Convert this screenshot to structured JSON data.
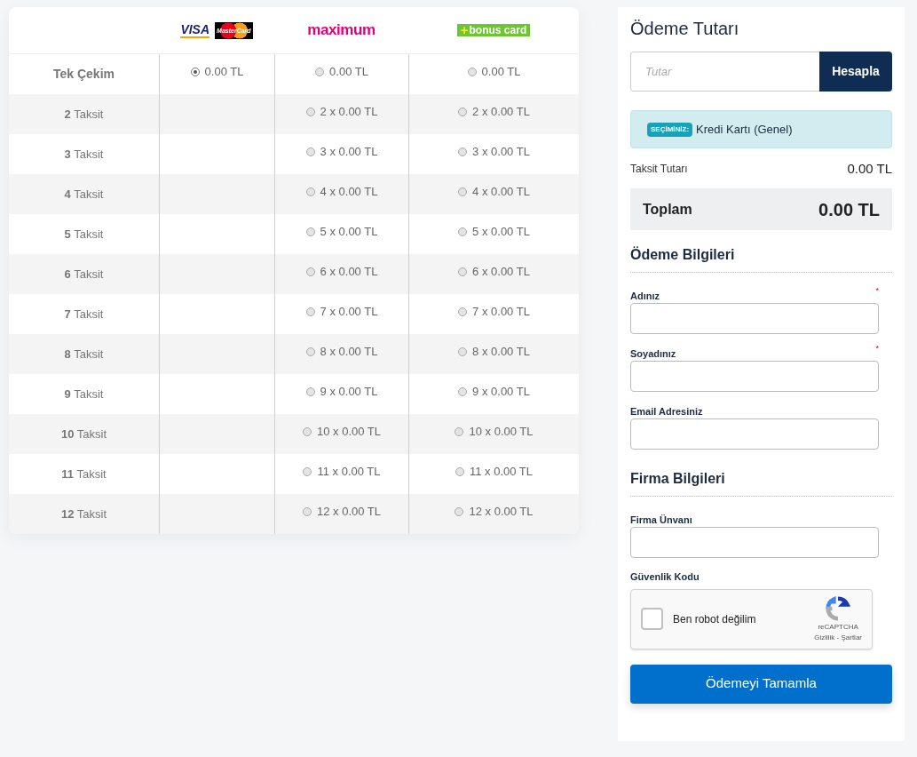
{
  "table": {
    "columns": [
      {
        "kind": "visa-mastercard",
        "logo_texts": [
          "VISA",
          "MasterCard"
        ]
      },
      {
        "kind": "maximum",
        "logo_texts": [
          "maximum"
        ]
      },
      {
        "kind": "bonus",
        "logo_texts": [
          "+",
          "bonus card"
        ]
      }
    ],
    "rows": [
      {
        "label": "Tek Çekim",
        "cells": [
          {
            "kind": "option",
            "text": "0.00 TL",
            "selected": true
          },
          {
            "kind": "option",
            "text": "0.00 TL",
            "selected": false
          },
          {
            "kind": "option",
            "text": "0.00 TL",
            "selected": false
          }
        ]
      },
      {
        "label": "**2** Taksit",
        "cells": [
          {
            "kind": "empty"
          },
          {
            "kind": "option",
            "text": "2 x 0.00 TL",
            "selected": false
          },
          {
            "kind": "option",
            "text": "2 x 0.00 TL",
            "selected": false
          }
        ]
      },
      {
        "label": "**3** Taksit",
        "cells": [
          {
            "kind": "empty"
          },
          {
            "kind": "option",
            "text": "3 x 0.00 TL",
            "selected": false
          },
          {
            "kind": "option",
            "text": "3 x 0.00 TL",
            "selected": false
          }
        ]
      },
      {
        "label": "**4** Taksit",
        "cells": [
          {
            "kind": "empty"
          },
          {
            "kind": "option",
            "text": "4 x 0.00 TL",
            "selected": false
          },
          {
            "kind": "option",
            "text": "4 x 0.00 TL",
            "selected": false
          }
        ]
      },
      {
        "label": "**5** Taksit",
        "cells": [
          {
            "kind": "empty"
          },
          {
            "kind": "option",
            "text": "5 x 0.00 TL",
            "selected": false
          },
          {
            "kind": "option",
            "text": "5 x 0.00 TL",
            "selected": false
          }
        ]
      },
      {
        "label": "**6** Taksit",
        "cells": [
          {
            "kind": "empty"
          },
          {
            "kind": "option",
            "text": "6 x 0.00 TL",
            "selected": false
          },
          {
            "kind": "option",
            "text": "6 x 0.00 TL",
            "selected": false
          }
        ]
      },
      {
        "label": "**7** Taksit",
        "cells": [
          {
            "kind": "empty"
          },
          {
            "kind": "option",
            "text": "7 x 0.00 TL",
            "selected": false
          },
          {
            "kind": "option",
            "text": "7 x 0.00 TL",
            "selected": false
          }
        ]
      },
      {
        "label": "**8** Taksit",
        "cells": [
          {
            "kind": "empty"
          },
          {
            "kind": "option",
            "text": "8 x 0.00 TL",
            "selected": false
          },
          {
            "kind": "option",
            "text": "8 x 0.00 TL",
            "selected": false
          }
        ]
      },
      {
        "label": "**9** Taksit",
        "cells": [
          {
            "kind": "empty"
          },
          {
            "kind": "option",
            "text": "9 x 0.00 TL",
            "selected": false
          },
          {
            "kind": "option",
            "text": "9 x 0.00 TL",
            "selected": false
          }
        ]
      },
      {
        "label": "**10** Taksit",
        "cells": [
          {
            "kind": "empty"
          },
          {
            "kind": "option",
            "text": "10 x 0.00 TL",
            "selected": false
          },
          {
            "kind": "option",
            "text": "10 x 0.00 TL",
            "selected": false
          }
        ]
      },
      {
        "label": "**11** Taksit",
        "cells": [
          {
            "kind": "empty"
          },
          {
            "kind": "option",
            "text": "11 x 0.00 TL",
            "selected": false
          },
          {
            "kind": "option",
            "text": "11 x 0.00 TL",
            "selected": false
          }
        ]
      },
      {
        "label": "**12** Taksit",
        "cells": [
          {
            "kind": "empty"
          },
          {
            "kind": "option",
            "text": "12 x 0.00 TL",
            "selected": false
          },
          {
            "kind": "option",
            "text": "12 x 0.00 TL",
            "selected": false
          }
        ]
      }
    ]
  },
  "payment": {
    "title": "Ödeme Tutarı",
    "amount_placeholder": "Tutar",
    "calculate_button": "Hesapla",
    "selection": {
      "badge": "SEÇİMİNİZ:",
      "text": "Kredi Kartı (Genel)"
    },
    "installment": {
      "label": "Taksit Tutarı",
      "value": "0.00 TL"
    },
    "total": {
      "label": "Toplam",
      "value": "0.00 TL"
    }
  },
  "sections": [
    {
      "title": "Ödeme Bilgileri",
      "fields": [
        {
          "label": "Adınız",
          "required_mark": "*"
        },
        {
          "label": "Soyadınız",
          "required_mark": "*"
        },
        {
          "label": "Email Adresiniz"
        }
      ]
    },
    {
      "title": "Firma Bilgileri",
      "fields": [
        {
          "label": "Firma Ünvanı"
        }
      ]
    }
  ],
  "captcha": {
    "label": "Güvenlik Kodu",
    "checkbox_text": "Ben robot değilim",
    "checked": false,
    "brand": "reCAPTCHA",
    "links": "Gizlilik - Şartlar"
  },
  "submit_button": "Ödemeyi Tamamla"
}
